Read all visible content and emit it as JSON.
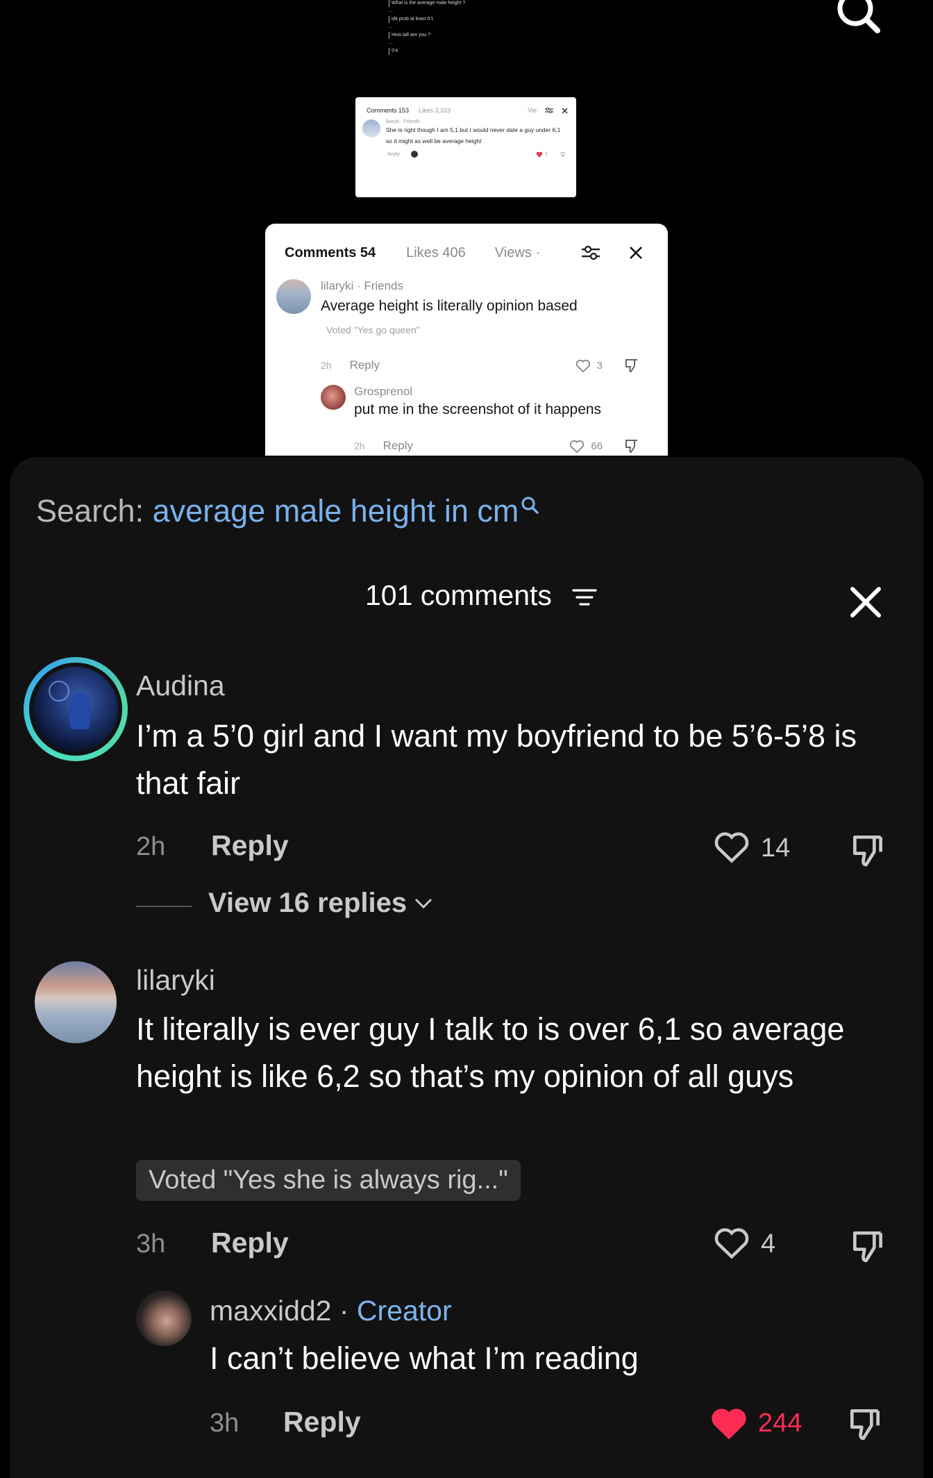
{
  "background_tiny_screenshot": {
    "lines": [
      "What is the average male height ?",
      "idk prob at least 6'1",
      "How tall are you ?",
      "5'4"
    ]
  },
  "card_small": {
    "tabs": {
      "comments": "Comments 153",
      "likes": "Likes 3,333",
      "views": "Vie"
    },
    "comment": {
      "username": "lilaryki · Friends",
      "text": "She is right though I am 5,1 but I would never date a guy under 6,1 so it might as well be average height",
      "reply_label": "Reply",
      "likes": "2"
    }
  },
  "card_medium": {
    "tabs": {
      "comments": "Comments 54",
      "likes": "Likes 406",
      "views": "Views ·"
    },
    "comment": {
      "username": "lilaryki · Friends",
      "text": "Average height is literally opinion based",
      "vote": "Voted \"Yes go queen\"",
      "time": "2h",
      "reply_label": "Reply",
      "likes": "3"
    },
    "reply": {
      "username": "Grosprenol",
      "text": "put me in the screenshot of it happens",
      "time": "2h",
      "reply_label": "Reply",
      "likes": "66"
    }
  },
  "sheet": {
    "search_prefix": "Search:",
    "search_query": "average male height in cm",
    "comments_title": "101 comments",
    "comments": [
      {
        "username": "Audina",
        "text": "I’m a 5’0 girl and I want my boyfriend to be 5’6-5’8 is that fair",
        "time": "2h",
        "reply_label": "Reply",
        "likes": "14",
        "view_replies": "View 16 replies"
      },
      {
        "username": "lilaryki",
        "text": "It literally is ever guy I talk to is over 6,1 so average height is like 6,2 so that’s my opinion of all guys",
        "vote": "Voted \"Yes she is always rig...\"",
        "time": "3h",
        "reply_label": "Reply",
        "likes": "4"
      }
    ],
    "creator_reply": {
      "username": "maxxidd2",
      "separator": " · ",
      "badge": "Creator",
      "text": "I can’t believe what I’m reading",
      "time": "3h",
      "reply_label": "Reply",
      "likes": "244"
    }
  },
  "colors": {
    "sheet_bg": "#121212",
    "link_blue": "#79b1ec",
    "like_red": "#fe2c55"
  }
}
